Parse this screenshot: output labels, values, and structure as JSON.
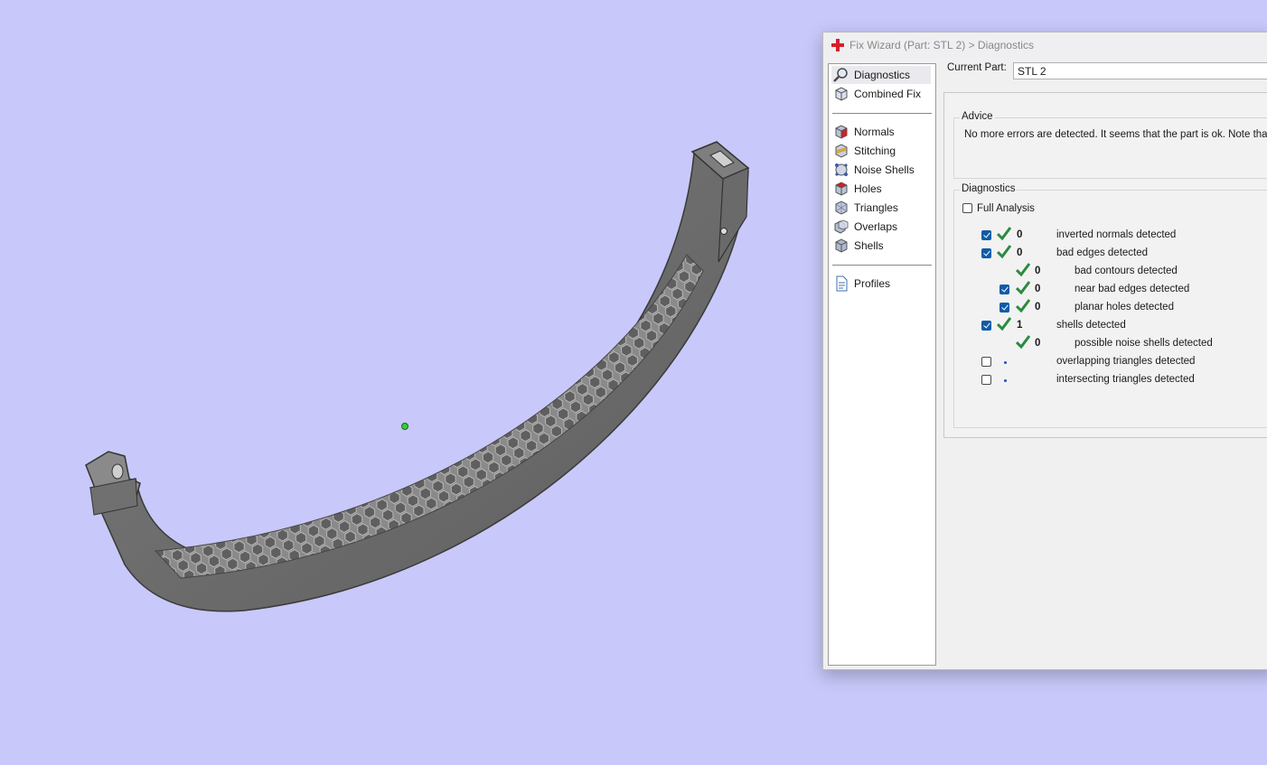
{
  "dialog": {
    "title": "Fix Wizard (Part: STL 2) > Diagnostics",
    "title_icon": "red-cross-icon"
  },
  "nav": {
    "items": [
      {
        "label": "Diagnostics",
        "icon": "magnifier-icon",
        "selected": true
      },
      {
        "label": "Combined Fix",
        "icon": "combined-fix-icon"
      },
      {
        "label": "Normals",
        "icon": "normals-cube-icon"
      },
      {
        "label": "Stitching",
        "icon": "stitching-cube-icon"
      },
      {
        "label": "Noise Shells",
        "icon": "noise-shells-icon"
      },
      {
        "label": "Holes",
        "icon": "holes-cube-icon"
      },
      {
        "label": "Triangles",
        "icon": "triangles-cube-icon"
      },
      {
        "label": "Overlaps",
        "icon": "overlaps-cube-icon"
      },
      {
        "label": "Shells",
        "icon": "shells-cube-icon"
      },
      {
        "label": "Profiles",
        "icon": "profiles-document-icon"
      }
    ]
  },
  "current_part": {
    "label": "Current Part:",
    "value": "STL 2"
  },
  "advice": {
    "title": "Advice",
    "text": "No more errors are detected. It seems that the part is ok. Note that n"
  },
  "diagnostics": {
    "title": "Diagnostics",
    "full_analysis": {
      "label": "Full Analysis",
      "checked": false
    },
    "rows": [
      {
        "label": "inverted normals detected",
        "count": "0",
        "checked": true,
        "status": "ok"
      },
      {
        "label": "bad edges detected",
        "count": "0",
        "checked": true,
        "status": "ok"
      },
      {
        "label": "bad contours detected",
        "count": "0",
        "status": "ok"
      },
      {
        "label": "near bad edges detected",
        "count": "0",
        "checked": true,
        "status": "ok"
      },
      {
        "label": "planar holes detected",
        "count": "0",
        "checked": true,
        "status": "ok"
      },
      {
        "label": "shells detected",
        "count": "1",
        "checked": true,
        "status": "ok"
      },
      {
        "label": "possible noise shells detected",
        "count": "0",
        "status": "ok"
      },
      {
        "label": "overlapping triangles detected",
        "count": "",
        "checked": false,
        "status": "pending"
      },
      {
        "label": "intersecting triangles detected",
        "count": "",
        "checked": false,
        "status": "pending"
      }
    ]
  },
  "colors": {
    "viewport_bg": "#c8c8fa",
    "check_green": "#2a8a3e",
    "checkbox_blue": "#0d5ca8",
    "title_icon_red": "#d4202a"
  }
}
